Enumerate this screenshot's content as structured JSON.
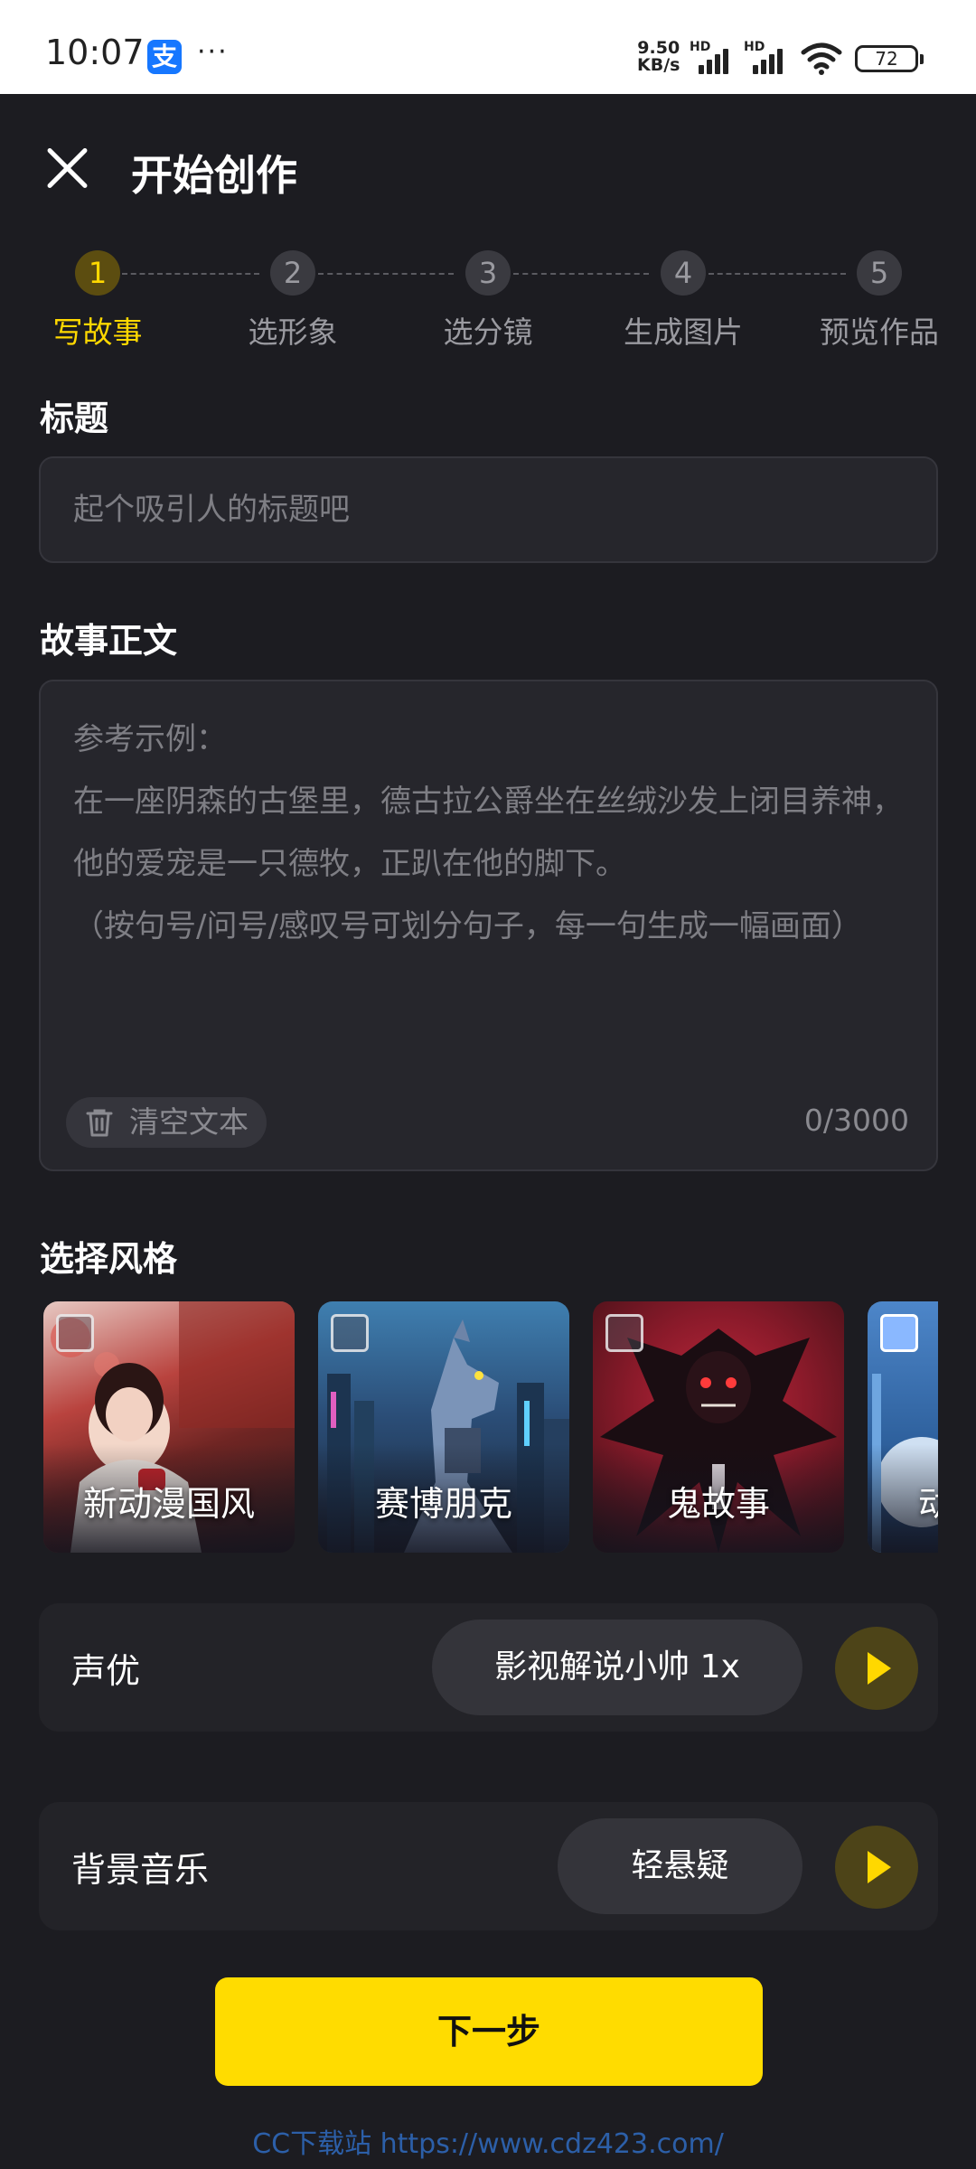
{
  "status_bar": {
    "time": "10:07",
    "notif_icon_char": "支",
    "dots": "···",
    "net_speed_value": "9.50",
    "net_speed_unit": "KB/s",
    "hd_label": "HD",
    "battery": "72"
  },
  "header": {
    "title": "开始创作"
  },
  "stepper": {
    "steps": [
      {
        "number": "1",
        "label": "写故事",
        "active": true
      },
      {
        "number": "2",
        "label": "选形象",
        "active": false
      },
      {
        "number": "3",
        "label": "选分镜",
        "active": false
      },
      {
        "number": "4",
        "label": "生成图片",
        "active": false
      },
      {
        "number": "5",
        "label": "预览作品",
        "active": false
      }
    ]
  },
  "title_section": {
    "label": "标题",
    "placeholder": "起个吸引人的标题吧"
  },
  "story_section": {
    "label": "故事正文",
    "placeholder_lines": [
      "参考示例：",
      "在一座阴森的古堡里，德古拉公爵坐在丝绒沙发上闭目养神，他的爱宠是一只德牧，正趴在他的脚下。",
      "（按句号/问号/感叹号可划分句子，每一句生成一幅画面）"
    ],
    "clear_label": "清空文本",
    "char_count": "0/3000"
  },
  "style_section": {
    "label": "选择风格",
    "styles": [
      {
        "name": "新动漫国风"
      },
      {
        "name": "赛博朋克"
      },
      {
        "name": "鬼故事"
      },
      {
        "name": "动"
      }
    ]
  },
  "voice": {
    "label": "声优",
    "value": "影视解说小帅 1x"
  },
  "music": {
    "label": "背景音乐",
    "value": "轻悬疑"
  },
  "next_button": "下一步",
  "watermark": "CC下载站 https://www.cdz423.com/",
  "colors": {
    "accent": "#ffdc00",
    "background": "#1c1c21",
    "active_step": "#ffd800"
  }
}
